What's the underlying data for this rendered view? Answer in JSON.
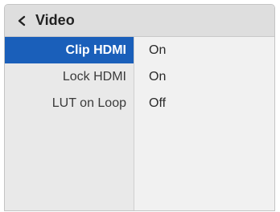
{
  "header": {
    "title": "Video",
    "back_icon": "chevron-left-icon"
  },
  "settings": [
    {
      "label": "Clip HDMI",
      "value": "On",
      "selected": true
    },
    {
      "label": "Lock HDMI",
      "value": "On",
      "selected": false
    },
    {
      "label": "LUT on Loop",
      "value": "Off",
      "selected": false
    }
  ],
  "colors": {
    "selection": "#1a5fba",
    "header_bg": "#dedede",
    "sidebar_bg": "#e9e9e9",
    "content_bg": "#f1f1f1"
  }
}
